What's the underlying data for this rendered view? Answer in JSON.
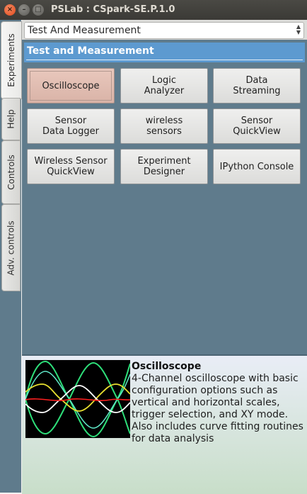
{
  "window": {
    "title": "PSLab : CSpark-SE.P.1.0",
    "close_glyph": "×",
    "minimize_glyph": "–",
    "maximize_glyph": "□"
  },
  "tabs": [
    "Experiments",
    "Help",
    "Controls",
    "Adv. controls"
  ],
  "category_select": {
    "value": "Test And Measurement"
  },
  "panel": {
    "title": "Test and Measurement"
  },
  "buttons": [
    {
      "label": "Oscilloscope",
      "selected": true
    },
    {
      "label": "Logic\nAnalyzer"
    },
    {
      "label": "Data\nStreaming"
    },
    {
      "label": "Sensor\nData Logger"
    },
    {
      "label": "wireless\nsensors"
    },
    {
      "label": "Sensor\nQuickView"
    },
    {
      "label": "Wireless Sensor\nQuickView"
    },
    {
      "label": "Experiment\nDesigner"
    },
    {
      "label": "IPython Console"
    }
  ],
  "description": {
    "title": "Oscilloscope",
    "text": "4-Channel oscilloscope with basic configuration options such as vertical and horizontal scales, trigger selection, and XY mode. Also includes curve fitting routines for data analysis"
  },
  "colors": {
    "panel_bg": "#5f7b8c",
    "header_bg": "#5d9ad0",
    "selected_button": "#e0bdb2",
    "trace_green": "#2ee07a",
    "trace_yellow": "#e8e030",
    "trace_white": "#ffffff",
    "trace_red": "#ff2020"
  }
}
